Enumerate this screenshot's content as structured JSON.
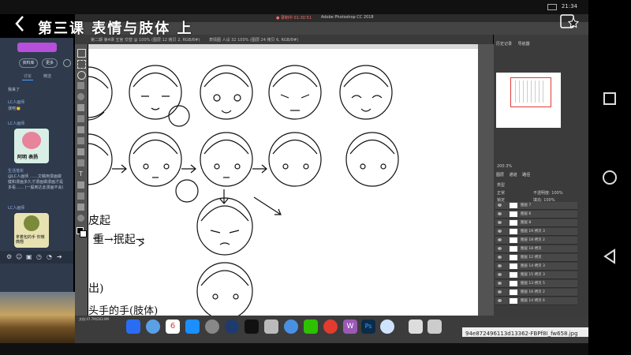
{
  "status_bar": {
    "time": "21:34",
    "battery": "",
    "carrier": ""
  },
  "header": {
    "back_icon": "chevron-left-icon",
    "title": "第三课 表情与肢体 上",
    "share_icon": "share-star-icon"
  },
  "ps": {
    "app_title": "Adobe Photoshop CC 2018",
    "recording": "● 录制中 01:30:51",
    "tabs": [
      "第二期 第4课 五官 交替 @ 100% (图层 12 拷贝 2, RGB/8#)",
      "表情图 人设 32 100% (图层 24 拷贝 6, RGB/8#)"
    ],
    "zoom": "200.3%",
    "doc_info": "文档:47.7M/263.9M",
    "panels": {
      "history": "历史记录",
      "navigator": "导航器",
      "layers": "图层",
      "channels": "通道",
      "paths": "路径",
      "kind": "类型",
      "normal": "正常",
      "opacity": "不透明度: 100%",
      "fill": "填充: 100%",
      "lock": "锁定"
    },
    "layers": [
      "图层 7",
      "图层 6",
      "图层 8",
      "图层 19 拷贝 3",
      "图层 18 拷贝 2",
      "图层 18 拷贝",
      "图层 12 拷贝",
      "图层 14 拷贝 3",
      "图层 15 拷贝 3",
      "图层 13 拷贝 5",
      "图层 16 拷贝 2",
      "图层 14 拷贝 6"
    ],
    "handwriting": [
      "皮起",
      "重→抿起→",
      "出)",
      "头手的手(肢体)"
    ]
  },
  "chat": {
    "buttons": [
      "资料库",
      "更多"
    ],
    "tabs": [
      "讨论",
      "精选"
    ],
    "messages": [
      {
        "user": "",
        "text": "我来了"
      },
      {
        "user": "LC人画师",
        "text": "涨吧👏"
      },
      {
        "user": "LC人画师",
        "text": "",
        "sticker_caption": "阿明 表扬"
      },
      {
        "user": "生活落实",
        "text": "@LC人画师 ……文稿用漫画做\n健和漫画多久才漫画做漫画才是\n多看…… (一般到达此漫画不会)"
      },
      {
        "user": "LC人画师",
        "text": "",
        "sticker_caption": "拿着包的手 你微微翘"
      }
    ]
  },
  "bottom": {
    "filename": "94e872496113d13362-FBPf8I_fw658.jpg"
  },
  "phone_nav": [
    "square-icon",
    "circle-icon",
    "triangle-back-icon"
  ],
  "colors": {
    "chat_bg": "#2f3a4c",
    "ps_dark": "#535353",
    "accent_red": "#e23a3a"
  }
}
